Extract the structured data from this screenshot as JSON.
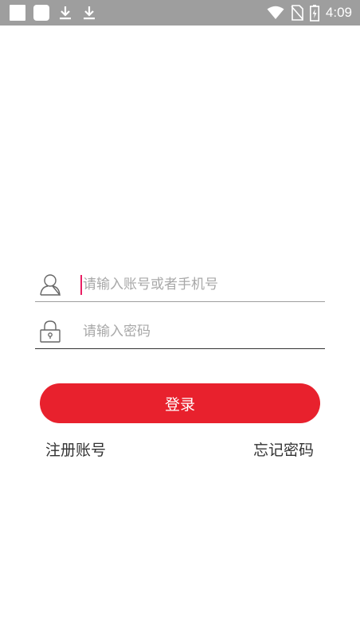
{
  "status_bar": {
    "time": "4:09",
    "left_icons": [
      "notification-square-icon",
      "notification-rounded-square-icon",
      "download-icon",
      "download-icon"
    ],
    "right_icons": [
      "wifi-icon",
      "no-sim-icon",
      "battery-charging-icon"
    ]
  },
  "login_form": {
    "username": {
      "icon": "user-icon",
      "placeholder": "请输入账号或者手机号",
      "value": ""
    },
    "password": {
      "icon": "lock-icon",
      "placeholder": "请输入密码",
      "value": ""
    },
    "login_button_label": "登录",
    "register_link": "注册账号",
    "forgot_password_link": "忘记密码"
  },
  "colors": {
    "status_bar_bg": "#9e9e9e",
    "primary_button": "#e8212d",
    "cursor": "#e91e63",
    "placeholder": "#a8a8a8",
    "link_text": "#333333"
  }
}
